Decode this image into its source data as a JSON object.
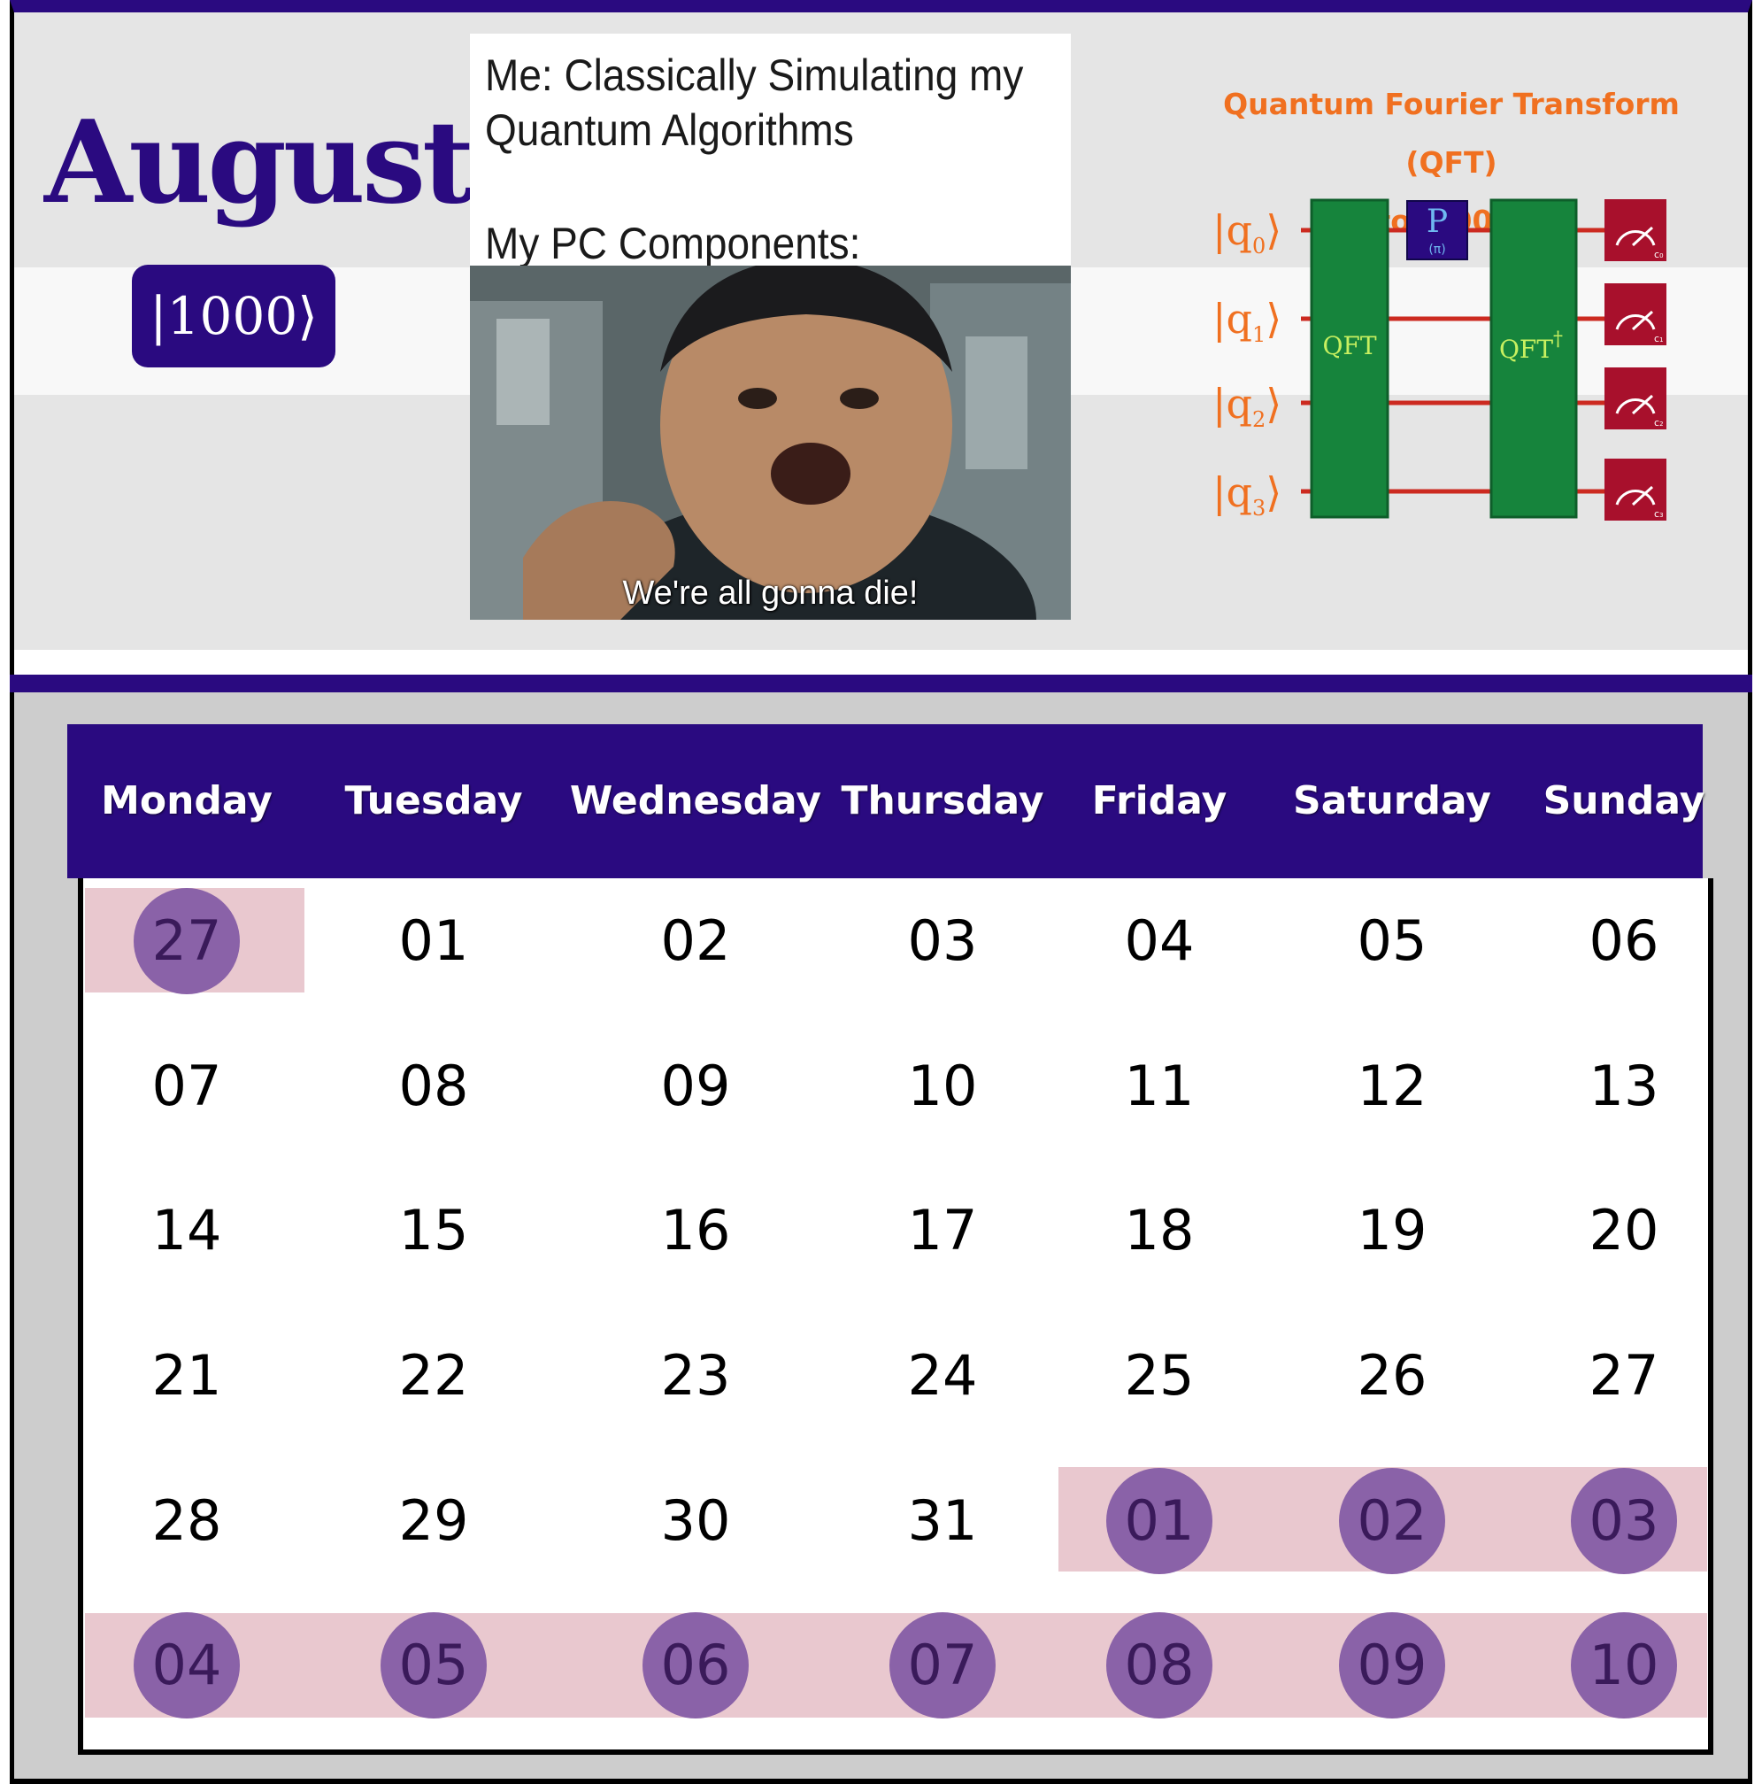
{
  "header": {
    "month": "August",
    "ket": "|1000⟩"
  },
  "meme": {
    "caption_line1": "Me: Classically Simulating my",
    "caption_line2": "Quantum Algorithms",
    "caption_line3": "My PC Components:",
    "subtitle": "We're all gonna die!"
  },
  "circuit": {
    "title_line1": "Quantum Fourier Transform (QFT)",
    "title_line2": "to  |1000⟩",
    "qubits": [
      "q",
      "q",
      "q",
      "q"
    ],
    "qubit_indices": [
      "0",
      "1",
      "2",
      "3"
    ],
    "qft_label": "QFT",
    "qft_dag_label": "QFT",
    "dagger": "†",
    "p_gate": "P",
    "p_param": "(π)",
    "classical": [
      "c",
      "c",
      "c",
      "c"
    ],
    "colors": {
      "qubit_label": "#f07020",
      "wire": "#cc2a20",
      "qft_box": "#16843c",
      "qft_text": "#c8f060",
      "p_gate": "#2a0a80",
      "measure": "#a8102c"
    }
  },
  "calendar": {
    "days": [
      "Monday",
      "Tuesday",
      "Wednesday",
      "Thursday",
      "Friday",
      "Saturday",
      "Sunday"
    ],
    "weeks": [
      [
        "27",
        "01",
        "02",
        "03",
        "04",
        "05",
        "06"
      ],
      [
        "07",
        "08",
        "09",
        "10",
        "11",
        "12",
        "13"
      ],
      [
        "14",
        "15",
        "16",
        "17",
        "18",
        "19",
        "20"
      ],
      [
        "21",
        "22",
        "23",
        "24",
        "25",
        "26",
        "27"
      ],
      [
        "28",
        "29",
        "30",
        "31",
        "01",
        "02",
        "03"
      ],
      [
        "04",
        "05",
        "06",
        "07",
        "08",
        "09",
        "10"
      ]
    ],
    "other_month": [
      [
        true,
        false,
        false,
        false,
        false,
        false,
        false
      ],
      [
        false,
        false,
        false,
        false,
        false,
        false,
        false
      ],
      [
        false,
        false,
        false,
        false,
        false,
        false,
        false
      ],
      [
        false,
        false,
        false,
        false,
        false,
        false,
        false
      ],
      [
        false,
        false,
        false,
        false,
        true,
        true,
        true
      ],
      [
        true,
        true,
        true,
        true,
        true,
        true,
        true
      ]
    ],
    "colors": {
      "header": "#2a0a80",
      "highlight": "#e9c8cf",
      "dot": "#8a62a8"
    }
  }
}
